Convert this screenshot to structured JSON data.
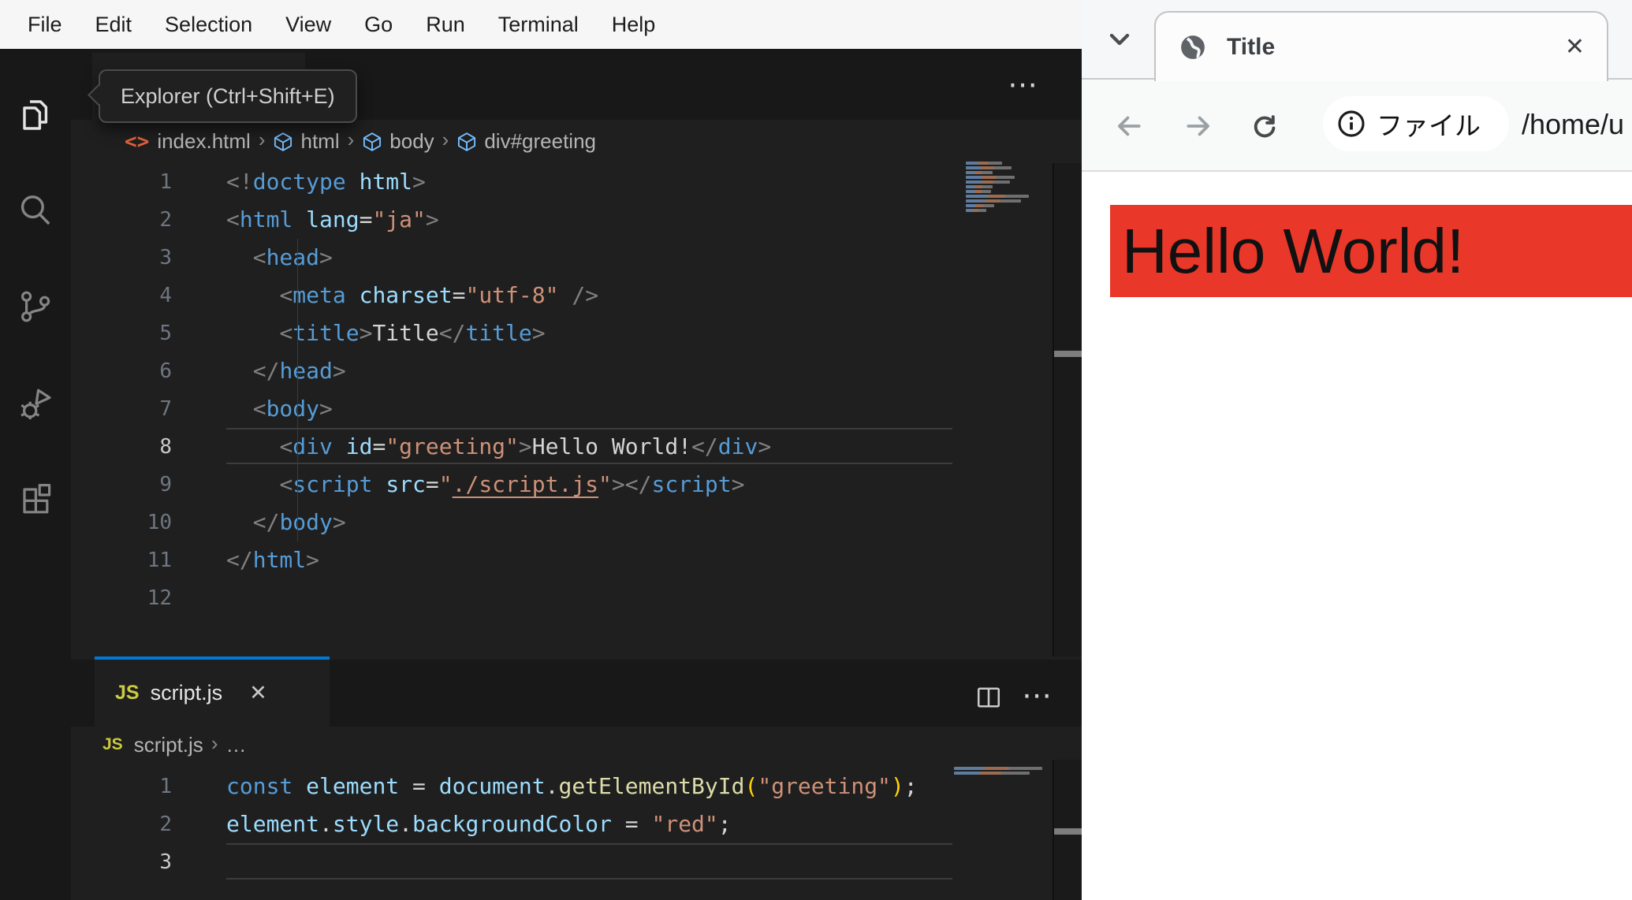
{
  "vscode": {
    "menu_items": [
      "File",
      "Edit",
      "Selection",
      "View",
      "Go",
      "Run",
      "Terminal",
      "Help"
    ],
    "activity_icons": [
      {
        "name": "explorer-icon",
        "active": true
      },
      {
        "name": "search-icon",
        "active": false
      },
      {
        "name": "source-control-icon",
        "active": false
      },
      {
        "name": "run-debug-icon",
        "active": false
      },
      {
        "name": "extensions-icon",
        "active": false
      }
    ],
    "tooltip": "Explorer (Ctrl+Shift+E)",
    "editor_actions_glyph": "⋯",
    "top_editor": {
      "breadcrumbs": [
        {
          "icon": "html-file",
          "label": "index.html"
        },
        {
          "icon": "cube",
          "label": "html"
        },
        {
          "icon": "cube",
          "label": "body"
        },
        {
          "icon": "cube",
          "label": "div#greeting"
        }
      ],
      "active_line": 8,
      "lines": [
        {
          "n": "1",
          "t": [
            [
              "punct",
              "<!"
            ],
            [
              "tag",
              "doctype"
            ],
            [
              "pln",
              " "
            ],
            [
              "attr",
              "html"
            ],
            [
              "punct",
              ">"
            ]
          ]
        },
        {
          "n": "2",
          "t": [
            [
              "punct",
              "<"
            ],
            [
              "tag",
              "html"
            ],
            [
              "pln",
              " "
            ],
            [
              "attr",
              "lang"
            ],
            [
              "op",
              "="
            ],
            [
              "val",
              "\"ja\""
            ],
            [
              "punct",
              ">"
            ]
          ]
        },
        {
          "n": "3",
          "t": [
            [
              "pln",
              "  "
            ],
            [
              "punct",
              "<"
            ],
            [
              "tag",
              "head"
            ],
            [
              "punct",
              ">"
            ]
          ]
        },
        {
          "n": "4",
          "t": [
            [
              "pln",
              "    "
            ],
            [
              "punct",
              "<"
            ],
            [
              "tag",
              "meta"
            ],
            [
              "pln",
              " "
            ],
            [
              "attr",
              "charset"
            ],
            [
              "op",
              "="
            ],
            [
              "val",
              "\"utf-8\""
            ],
            [
              "pln",
              " "
            ],
            [
              "punct",
              "/>"
            ]
          ]
        },
        {
          "n": "5",
          "t": [
            [
              "pln",
              "    "
            ],
            [
              "punct",
              "<"
            ],
            [
              "tag",
              "title"
            ],
            [
              "punct",
              ">"
            ],
            [
              "txt",
              "Title"
            ],
            [
              "punct",
              "</"
            ],
            [
              "tag",
              "title"
            ],
            [
              "punct",
              ">"
            ]
          ]
        },
        {
          "n": "6",
          "t": [
            [
              "pln",
              "  "
            ],
            [
              "punct",
              "</"
            ],
            [
              "tag",
              "head"
            ],
            [
              "punct",
              ">"
            ]
          ]
        },
        {
          "n": "7",
          "t": [
            [
              "pln",
              "  "
            ],
            [
              "punct",
              "<"
            ],
            [
              "tag",
              "body"
            ],
            [
              "punct",
              ">"
            ]
          ]
        },
        {
          "n": "8",
          "t": [
            [
              "pln",
              "    "
            ],
            [
              "punct",
              "<"
            ],
            [
              "tag",
              "div"
            ],
            [
              "pln",
              " "
            ],
            [
              "attr",
              "id"
            ],
            [
              "op",
              "="
            ],
            [
              "val",
              "\"greeting\""
            ],
            [
              "punct",
              ">"
            ],
            [
              "txt",
              "Hello World!"
            ],
            [
              "punct",
              "</"
            ],
            [
              "tag",
              "div"
            ],
            [
              "punct",
              ">"
            ]
          ]
        },
        {
          "n": "9",
          "t": [
            [
              "pln",
              "    "
            ],
            [
              "punct",
              "<"
            ],
            [
              "tag",
              "script"
            ],
            [
              "pln",
              " "
            ],
            [
              "attr",
              "src"
            ],
            [
              "op",
              "="
            ],
            [
              "val",
              "\""
            ],
            [
              "link",
              "./script.js"
            ],
            [
              "val",
              "\""
            ],
            [
              "punct",
              ">"
            ],
            [
              "punct",
              "</"
            ],
            [
              "tag",
              "script"
            ],
            [
              "punct",
              ">"
            ]
          ]
        },
        {
          "n": "10",
          "t": [
            [
              "pln",
              "  "
            ],
            [
              "punct",
              "</"
            ],
            [
              "tag",
              "body"
            ],
            [
              "punct",
              ">"
            ]
          ]
        },
        {
          "n": "11",
          "t": [
            [
              "punct",
              "</"
            ],
            [
              "tag",
              "html"
            ],
            [
              "punct",
              ">"
            ]
          ]
        },
        {
          "n": "12",
          "t": []
        }
      ]
    },
    "panel_editor": {
      "tab": {
        "icon": "JS",
        "label": "script.js",
        "close_glyph": "✕"
      },
      "actions_glyph": "⋯",
      "breadcrumb": {
        "icon": "JS",
        "label": "script.js",
        "more": "…"
      },
      "active_line": 3,
      "lines": [
        {
          "n": "1",
          "t": [
            [
              "kw",
              "const"
            ],
            [
              "pln",
              " "
            ],
            [
              "var",
              "element"
            ],
            [
              "op",
              " = "
            ],
            [
              "var",
              "document"
            ],
            [
              "op",
              "."
            ],
            [
              "fn",
              "getElementById"
            ],
            [
              "br",
              "("
            ],
            [
              "val",
              "\"greeting\""
            ],
            [
              "br",
              ")"
            ],
            [
              "op",
              ";"
            ]
          ]
        },
        {
          "n": "2",
          "t": [
            [
              "var",
              "element"
            ],
            [
              "op",
              "."
            ],
            [
              "var",
              "style"
            ],
            [
              "op",
              "."
            ],
            [
              "var",
              "backgroundColor"
            ],
            [
              "op",
              " = "
            ],
            [
              "val",
              "\"red\""
            ],
            [
              "op",
              ";"
            ]
          ]
        },
        {
          "n": "3",
          "t": []
        }
      ]
    },
    "minimap_top_rows": [
      46,
      58,
      34,
      62,
      56,
      34,
      32,
      80,
      70,
      36,
      26
    ],
    "minimap_panel_rows": [
      112,
      96
    ]
  },
  "browser": {
    "tab": {
      "title": "Title",
      "close_glyph": "✕"
    },
    "toolbar": {
      "chip_label": "ファイル",
      "url": "/home/u"
    },
    "page": {
      "heading": "Hello World!"
    }
  },
  "colors": {
    "accent_blue": "#0078d4",
    "menu_bg": "#f6f6f6",
    "editor_bg": "#1f1f1f",
    "chrome_bg": "#181818",
    "banner_red": "#e9372a",
    "syntax_tag": "#569cd6",
    "syntax_attr": "#9cdcfe",
    "syntax_string": "#ce9178",
    "syntax_function": "#dcdcaa",
    "syntax_bracket": "#ffd700",
    "syntax_punct": "#808080",
    "line_number": "#6e7681",
    "js_badge": "#cbcb41",
    "cube_icon": "#75beff",
    "html_file_icon": "#e0603e"
  }
}
